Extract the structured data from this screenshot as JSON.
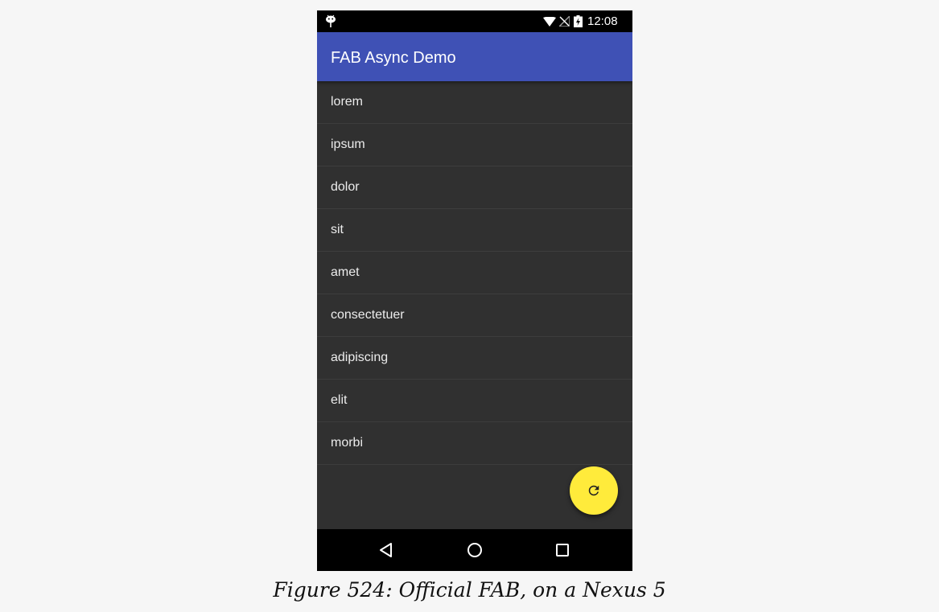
{
  "status_bar": {
    "time": "12:08",
    "icons": [
      "android-notification-icon",
      "wifi-icon",
      "no-signal-icon",
      "battery-charging-icon"
    ]
  },
  "app_bar": {
    "title": "FAB Async Demo"
  },
  "list": {
    "items": [
      "lorem",
      "ipsum",
      "dolor",
      "sit",
      "amet",
      "consectetuer",
      "adipiscing",
      "elit",
      "morbi"
    ]
  },
  "fab": {
    "icon": "refresh-icon",
    "color": "#ffeb3b"
  },
  "nav_bar": {
    "icons": [
      "back-icon",
      "home-icon",
      "recents-icon"
    ]
  },
  "caption": "Figure 524: Official FAB, on a Nexus 5",
  "colors": {
    "app_bar": "#3f51b5",
    "list_background": "#303030",
    "page_background": "#f6f6f6",
    "fab": "#ffeb3b"
  }
}
